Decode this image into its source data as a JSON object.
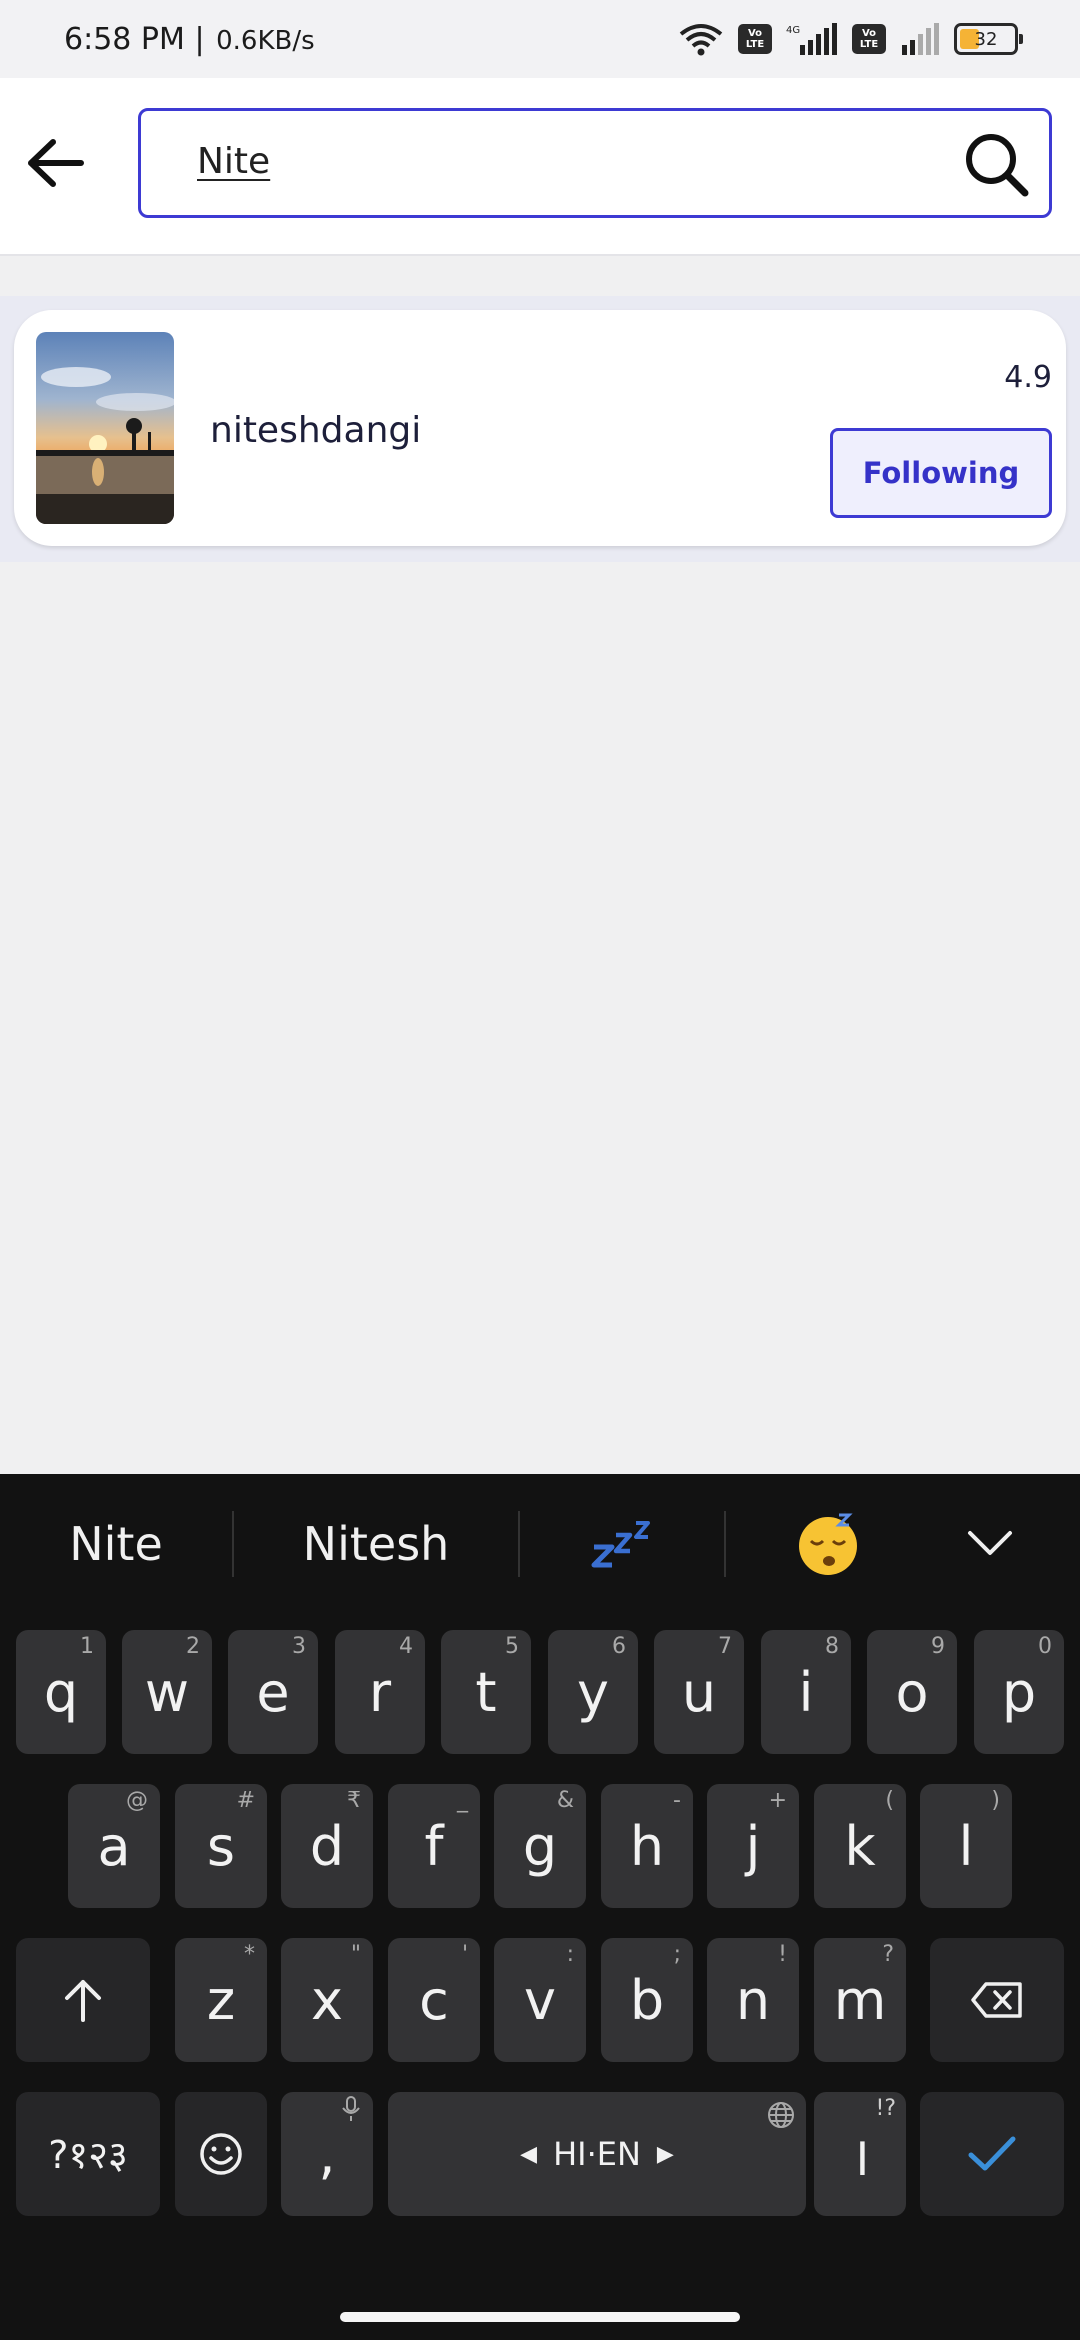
{
  "status_bar": {
    "time": "6:58 PM",
    "separator": "|",
    "network_speed": "0.6KB/s",
    "network_type": "4G",
    "volte_label": "Vo LTE",
    "battery_level": "32"
  },
  "search": {
    "query": "Nite"
  },
  "results": [
    {
      "username": "niteshdangi",
      "rating": "4.9",
      "follow_label": "Following"
    }
  ],
  "keyboard": {
    "suggestions": [
      "Nite",
      "Nitesh"
    ],
    "emoji_suggestions": [
      "zzz-icon",
      "sleeping-face-icon"
    ],
    "row1": [
      {
        "k": "q",
        "h": "1"
      },
      {
        "k": "w",
        "h": "2"
      },
      {
        "k": "e",
        "h": "3"
      },
      {
        "k": "r",
        "h": "4"
      },
      {
        "k": "t",
        "h": "5"
      },
      {
        "k": "y",
        "h": "6"
      },
      {
        "k": "u",
        "h": "7"
      },
      {
        "k": "i",
        "h": "8"
      },
      {
        "k": "o",
        "h": "9"
      },
      {
        "k": "p",
        "h": "0"
      }
    ],
    "row2": [
      {
        "k": "a",
        "h": "@"
      },
      {
        "k": "s",
        "h": "#"
      },
      {
        "k": "d",
        "h": "₹"
      },
      {
        "k": "f",
        "h": "_"
      },
      {
        "k": "g",
        "h": "&"
      },
      {
        "k": "h",
        "h": "-"
      },
      {
        "k": "j",
        "h": "+"
      },
      {
        "k": "k",
        "h": "("
      },
      {
        "k": "l",
        "h": ")"
      }
    ],
    "row3": [
      {
        "k": "z",
        "h": "*"
      },
      {
        "k": "x",
        "h": "\""
      },
      {
        "k": "c",
        "h": "'"
      },
      {
        "k": "v",
        "h": ":"
      },
      {
        "k": "b",
        "h": ";"
      },
      {
        "k": "n",
        "h": "!"
      },
      {
        "k": "m",
        "h": "?"
      }
    ],
    "symbols_label": "?१२३",
    "comma_label": ",",
    "space_label": "HI·EN",
    "period_label": "।",
    "period_hint": "!?",
    "colors": {
      "background": "#121212",
      "key": "#333335",
      "accent": "#3a8fd9"
    }
  },
  "colors": {
    "accent": "#3d3ad3",
    "page_background": "#f0f0f1"
  }
}
